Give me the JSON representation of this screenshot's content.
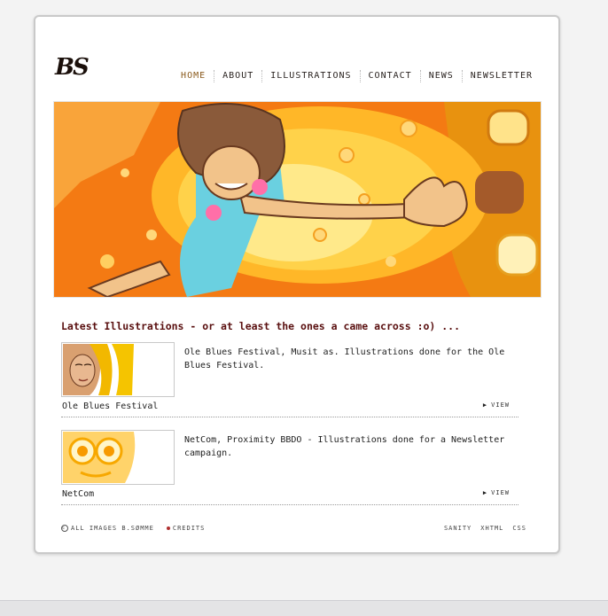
{
  "site": {
    "logo": "BS"
  },
  "nav": [
    {
      "label": "HOME",
      "active": true
    },
    {
      "label": "ABOUT",
      "active": false
    },
    {
      "label": "ILLUSTRATIONS",
      "active": false
    },
    {
      "label": "CONTACT",
      "active": false
    },
    {
      "label": "NEWS",
      "active": false
    },
    {
      "label": "NEWSLETTER",
      "active": false
    }
  ],
  "main": {
    "section_title": "Latest Illustrations - or at least the ones a came across :o) ...",
    "items": [
      {
        "title": "Ole Blues Festival",
        "description": "Ole Blues Festival, Musit as. Illustrations done for the Ole Blues Festival.",
        "view_label": "VIEW"
      },
      {
        "title": "NetCom",
        "description": "NetCom, Proximity BBDO - Illustrations done for a Newsletter campaign.",
        "view_label": "VIEW"
      }
    ]
  },
  "footer": {
    "copyright": "ALL IMAGES B.SØMME",
    "credits": "CREDITS",
    "links": [
      "SANITY",
      "XHTML",
      "CSS"
    ]
  },
  "colors": {
    "accent_title": "#5a1010",
    "nav_active": "#8a5a1c",
    "hero_orange": "#f47a13",
    "hero_yellow": "#ffd24a"
  }
}
